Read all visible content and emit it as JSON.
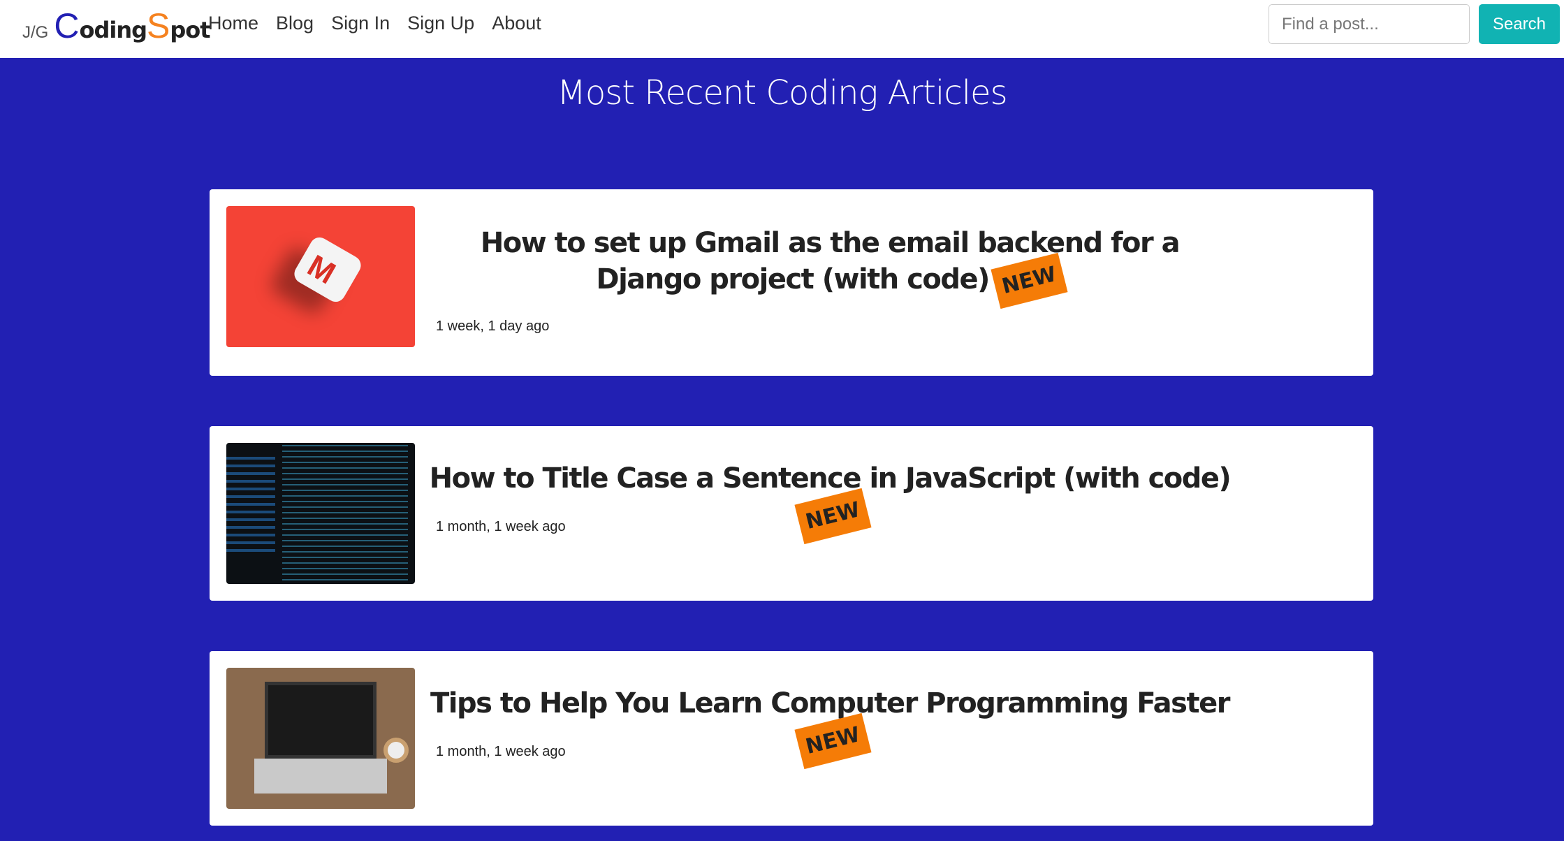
{
  "nav": {
    "logo": {
      "prefix": "J/G",
      "c": "C",
      "oding": "oding ",
      "s": "S",
      "pot": "pot"
    },
    "links": [
      "Home",
      "Blog",
      "Sign In",
      "Sign Up",
      "About"
    ],
    "search_placeholder": "Find a post...",
    "search_label": "Search"
  },
  "colors": {
    "brand_blue": "#2220b3",
    "brand_orange": "#f58220",
    "accent": "#11b3b3",
    "badge": "#f57c07"
  },
  "page_title": "Most Recent Coding Articles",
  "articles": [
    {
      "title": "How to set up Gmail as the email backend for a Django project (with code)",
      "badge": "NEW",
      "date": "1 week, 1 day ago",
      "image": "gmail-logo-image"
    },
    {
      "title": "How to Title Case a Sentence in JavaScript (with code)",
      "badge": "NEW",
      "date": "1 month, 1 week ago",
      "image": "code-screen-image"
    },
    {
      "title": "Tips to Help You Learn Computer Programming Faster",
      "badge": "NEW",
      "date": "1 month, 1 week ago",
      "image": "laptop-coffee-image"
    }
  ]
}
